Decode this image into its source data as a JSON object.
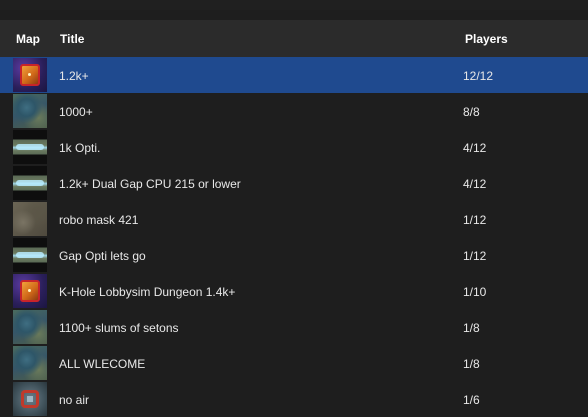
{
  "header": {
    "map": "Map",
    "title": "Title",
    "players": "Players"
  },
  "rows": [
    {
      "title": "1.2k+",
      "players": "12/12",
      "map_icon": "cube-map-icon"
    },
    {
      "title": "1000+",
      "players": "8/8",
      "map_icon": "water-map-icon"
    },
    {
      "title": "1k Opti.",
      "players": "4/12",
      "map_icon": "gap-map-icon"
    },
    {
      "title": "1.2k+ Dual Gap CPU 215 or lower",
      "players": "4/12",
      "map_icon": "gap-map-icon"
    },
    {
      "title": "robo mask 421",
      "players": "1/12",
      "map_icon": "robo-map-icon"
    },
    {
      "title": "Gap Opti lets go",
      "players": "1/12",
      "map_icon": "gap-map-icon"
    },
    {
      "title": "K-Hole Lobbysim Dungeon 1.4k+",
      "players": "1/10",
      "map_icon": "cube-map-icon"
    },
    {
      "title": "1100+ slums of setons",
      "players": "1/8",
      "map_icon": "water-map-icon"
    },
    {
      "title": "ALL WLECOME",
      "players": "1/8",
      "map_icon": "water-map-icon"
    },
    {
      "title": "no air",
      "players": "1/6",
      "map_icon": "noair-map-icon"
    }
  ],
  "selected_row": 0,
  "colors": {
    "selected": "#1f4a8f",
    "header": "#2b2b2b",
    "background": "#1e1e1e"
  }
}
